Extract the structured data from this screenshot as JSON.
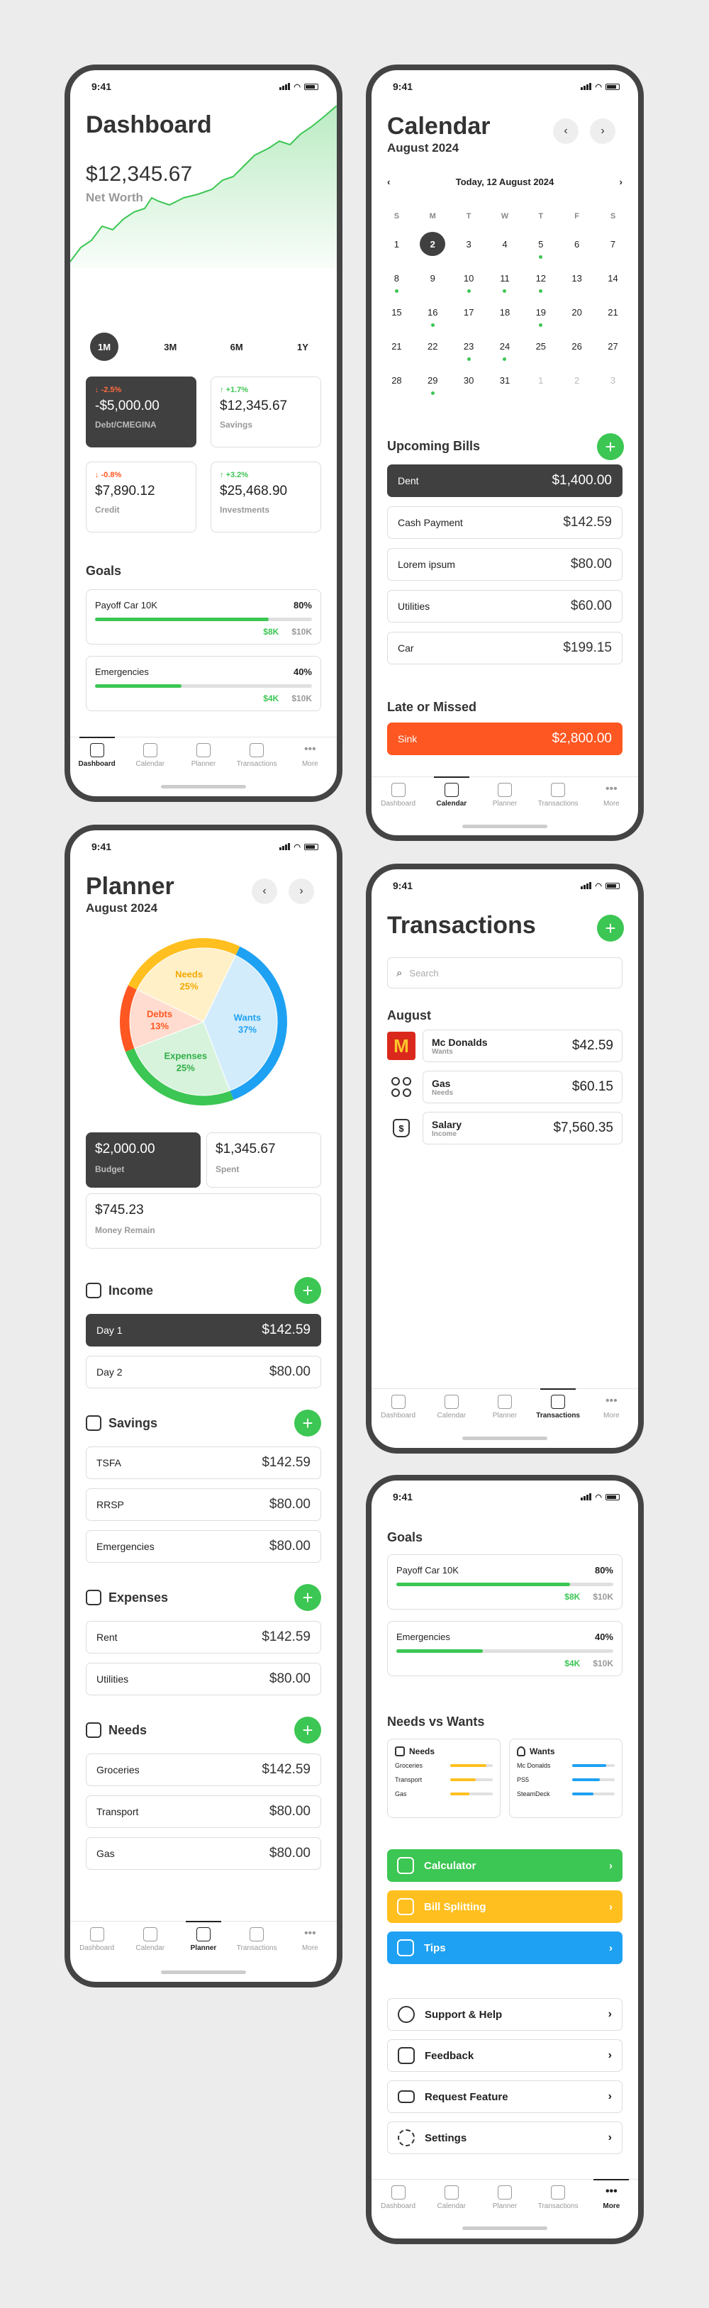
{
  "status_time": "9:41",
  "tabs": [
    "Dashboard",
    "Calendar",
    "Planner",
    "Transactions",
    "More"
  ],
  "dashboard": {
    "title": "Dashboard",
    "net_worth": "$12,345.67",
    "net_worth_label": "Net Worth",
    "ranges": [
      "1M",
      "3M",
      "6M",
      "1Y"
    ],
    "cards": [
      {
        "change": "-2.5%",
        "value": "-$5,000.00",
        "label": "Debt/CMEGINA",
        "direction": "down"
      },
      {
        "change": "+1.7%",
        "value": "$12,345.67",
        "label": "Savings",
        "direction": "up"
      },
      {
        "change": "-0.8%",
        "value": "$7,890.12",
        "label": "Credit",
        "direction": "down"
      },
      {
        "change": "+3.2%",
        "value": "$25,468.90",
        "label": "Investments",
        "direction": "up"
      }
    ],
    "goals_title": "Goals",
    "goals": [
      {
        "name": "Payoff Car 10K",
        "pct": "80%",
        "current": "$8K",
        "target": "$10K",
        "fraction": 0.8
      },
      {
        "name": "Emergencies",
        "pct": "40%",
        "current": "$4K",
        "target": "$10K",
        "fraction": 0.4
      }
    ]
  },
  "calendar": {
    "title": "Calendar",
    "month": "August 2024",
    "today": "Today, 12 August 2024",
    "weekdays": [
      "S",
      "M",
      "T",
      "W",
      "T",
      "F",
      "S"
    ],
    "weeks": [
      [
        "1",
        "2",
        "3",
        "4",
        "5",
        "6",
        "7"
      ],
      [
        "8",
        "9",
        "10",
        "11",
        "12",
        "13",
        "14"
      ],
      [
        "15",
        "16",
        "17",
        "18",
        "19",
        "20",
        "21"
      ],
      [
        "21",
        "22",
        "23",
        "24",
        "25",
        "26",
        "27"
      ],
      [
        "28",
        "29",
        "30",
        "31",
        "1",
        "2",
        "3"
      ]
    ],
    "upcoming_title": "Upcoming Bills",
    "upcoming": [
      {
        "name": "Dent",
        "amount": "$1,400.00"
      },
      {
        "name": "Cash Payment",
        "amount": "$142.59"
      },
      {
        "name": "Lorem ipsum",
        "amount": "$80.00"
      },
      {
        "name": "Utilities",
        "amount": "$60.00"
      },
      {
        "name": "Car",
        "amount": "$199.15"
      }
    ],
    "late_title": "Late or Missed",
    "late": [
      {
        "name": "Sink",
        "amount": "$2,800.00"
      }
    ]
  },
  "planner": {
    "title": "Planner",
    "month": "August 2024",
    "chart_data": {
      "type": "pie",
      "slices": [
        {
          "label": "Wants",
          "value": 37,
          "text": "37%",
          "color": "#1ea1f2"
        },
        {
          "label": "Expenses",
          "value": 25,
          "text": "25%",
          "color": "#3cc653"
        },
        {
          "label": "Debts",
          "value": 13,
          "text": "13%",
          "color": "#ff5722"
        },
        {
          "label": "Needs",
          "value": 25,
          "text": "25%",
          "color": "#ffbf1f"
        }
      ]
    },
    "budget": {
      "value": "$2,000.00",
      "label": "Budget"
    },
    "spent": {
      "value": "$1,345.67",
      "label": "Spent"
    },
    "remain": {
      "value": "$745.23",
      "label": "Money Remain"
    },
    "sections": [
      {
        "title": "Income",
        "rows": [
          {
            "name": "Day 1",
            "amount": "$142.59"
          },
          {
            "name": "Day 2",
            "amount": "$80.00"
          }
        ]
      },
      {
        "title": "Savings",
        "rows": [
          {
            "name": "TSFA",
            "amount": "$142.59"
          },
          {
            "name": "RRSP",
            "amount": "$80.00"
          },
          {
            "name": "Emergencies",
            "amount": "$80.00"
          }
        ]
      },
      {
        "title": "Expenses",
        "rows": [
          {
            "name": "Rent",
            "amount": "$142.59"
          },
          {
            "name": "Utilities",
            "amount": "$80.00"
          }
        ]
      },
      {
        "title": "Needs",
        "rows": [
          {
            "name": "Groceries",
            "amount": "$142.59"
          },
          {
            "name": "Transport",
            "amount": "$80.00"
          },
          {
            "name": "Gas",
            "amount": "$80.00"
          }
        ]
      }
    ]
  },
  "transactions": {
    "title": "Transactions",
    "search_placeholder": "Search",
    "month": "August",
    "items": [
      {
        "name": "Mc Donalds",
        "category": "Wants",
        "amount": "$42.59"
      },
      {
        "name": "Gas",
        "category": "Needs",
        "amount": "$60.15"
      },
      {
        "name": "Salary",
        "category": "Income",
        "amount": "$7,560.35"
      }
    ]
  },
  "more": {
    "goals_title": "Goals",
    "goals": [
      {
        "name": "Payoff Car 10K",
        "pct": "80%",
        "current": "$8K",
        "target": "$10K",
        "fraction": 0.8
      },
      {
        "name": "Emergencies",
        "pct": "40%",
        "current": "$4K",
        "target": "$10K",
        "fraction": 0.4
      }
    ],
    "nvw_title": "Needs vs Wants",
    "needs": {
      "title": "Needs",
      "items": [
        "Groceries",
        "Transport",
        "Gas"
      ]
    },
    "wants": {
      "title": "Wants",
      "items": [
        "Mc Donalds",
        "PS5",
        "SteamDeck"
      ]
    },
    "tools": [
      {
        "label": "Calculator",
        "color": "#3cc653"
      },
      {
        "label": "Bill Splitting",
        "color": "#ffbf1f"
      },
      {
        "label": "Tips",
        "color": "#1ea1f2"
      }
    ],
    "links": [
      "Support & Help",
      "Feedback",
      "Request Feature",
      "Settings"
    ]
  }
}
